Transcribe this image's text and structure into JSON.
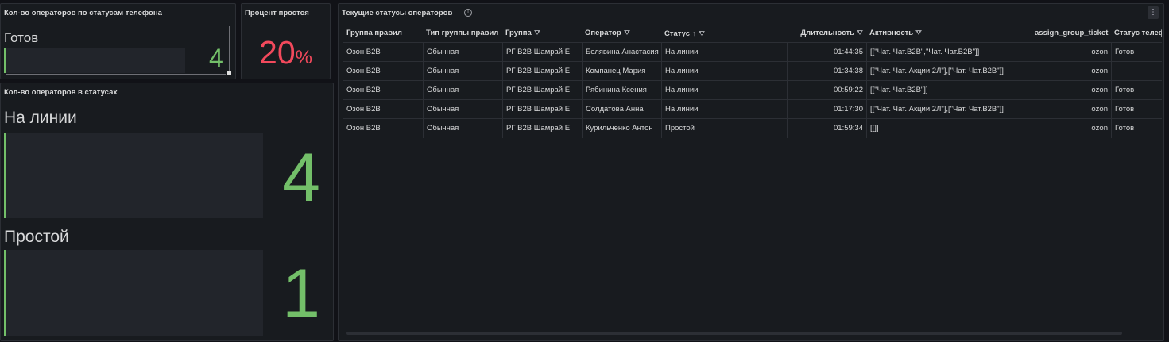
{
  "panel_phone_status": {
    "title": "Кол-во операторов по статусам телефона",
    "label": "Готов",
    "value": "4",
    "color": "#73bf69"
  },
  "panel_idle_percent": {
    "title": "Процент простоя",
    "value": "20",
    "unit": "%",
    "color": "#f2495c"
  },
  "panel_status_counts": {
    "title": "Кол-во операторов в статусах",
    "items": [
      {
        "label": "На линии",
        "value": "4"
      },
      {
        "label": "Простой",
        "value": "1"
      }
    ]
  },
  "panel_table": {
    "title": "Текущие статусы операторов",
    "columns": [
      "Группа правил",
      "Тип группы правил",
      "Группа",
      "Оператор",
      "Статус",
      "Длительность",
      "Активность",
      "assign_group_ticket",
      "Статус телефона"
    ],
    "sorted_column": "Статус",
    "rows": [
      [
        "Озон B2B",
        "Обычная",
        "РГ B2B Шамрай Е.",
        "Белявина Анастасия",
        "На линии",
        "01:44:35",
        "[[\"Чат. Чат.B2B\",\"Чат. Чат.B2B\"]]",
        "ozon",
        "Готов"
      ],
      [
        "Озон B2B",
        "Обычная",
        "РГ B2B Шамрай Е.",
        "Компанец Мария",
        "На линии",
        "01:34:38",
        "[[\"Чат. Чат. Акции 2Л\"],[\"Чат. Чат.B2B\"]]",
        "ozon",
        ""
      ],
      [
        "Озон B2B",
        "Обычная",
        "РГ B2B Шамрай Е.",
        "Рябинина Ксения",
        "На линии",
        "00:59:22",
        "[[\"Чат. Чат.B2B\"]]",
        "ozon",
        "Готов"
      ],
      [
        "Озон B2B",
        "Обычная",
        "РГ B2B Шамрай Е.",
        "Солдатова Анна",
        "На линии",
        "01:17:30",
        "[[\"Чат. Чат. Акции 2Л\"],[\"Чат. Чат.B2B\"]]",
        "ozon",
        "Готов"
      ],
      [
        "Озон B2B",
        "Обычная",
        "РГ B2B Шамрай Е.",
        "Курильченко Антон",
        "Простой",
        "01:59:34",
        "[[]]",
        "ozon",
        "Готов"
      ]
    ]
  },
  "icons": {
    "info": "info-icon",
    "menu": "kebab-menu-icon",
    "filter": "filter-icon",
    "sort": "sort-ascending-icon"
  },
  "colors": {
    "background": "#111217",
    "panel": "#181b1f",
    "green": "#73bf69",
    "red": "#f2495c"
  }
}
